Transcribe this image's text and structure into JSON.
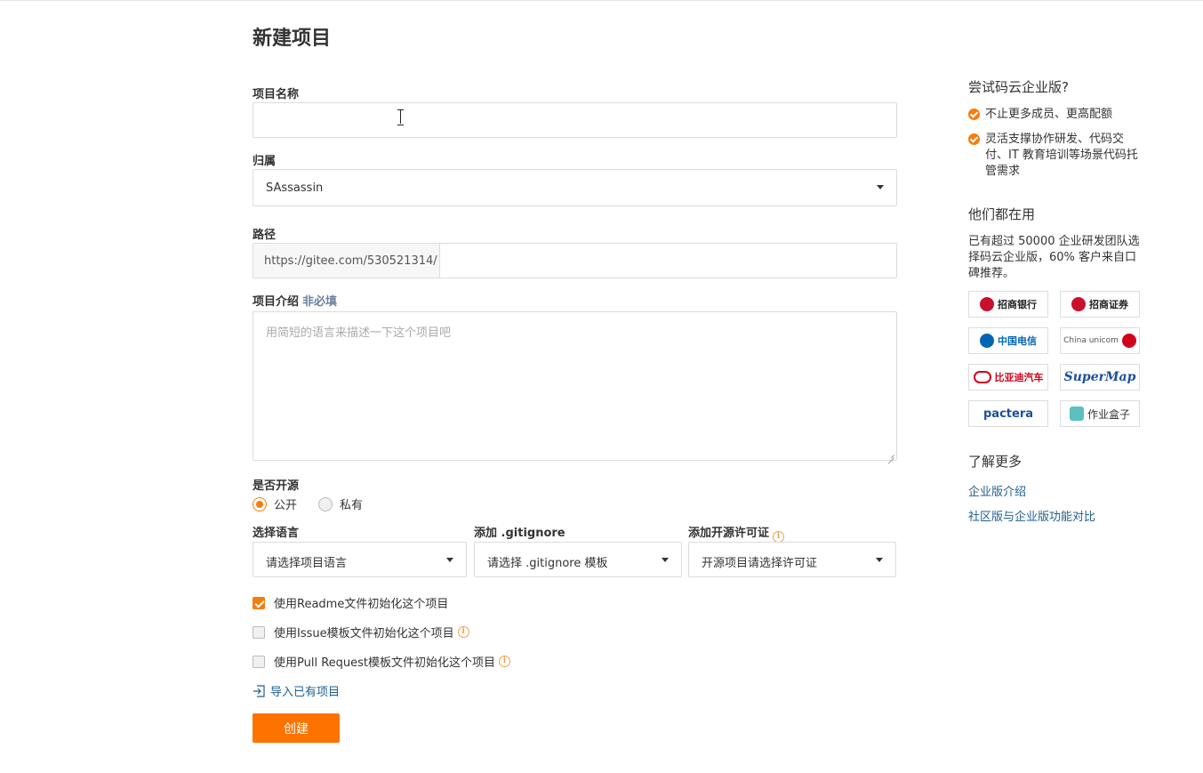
{
  "page": {
    "title": "新建项目"
  },
  "form": {
    "name": {
      "label": "项目名称",
      "value": ""
    },
    "owner": {
      "label": "归属",
      "value": "SAssassin"
    },
    "path": {
      "label": "路径",
      "prefix": "https://gitee.com/530521314/",
      "value": ""
    },
    "description": {
      "label": "项目介绍",
      "optional": "非必填",
      "placeholder": "用简短的语言来描述一下这个项目吧"
    },
    "visibility": {
      "label": "是否开源",
      "options": [
        "公开",
        "私有"
      ],
      "selected": "公开"
    },
    "language": {
      "label": "选择语言",
      "value": "请选择项目语言"
    },
    "gitignore": {
      "label": "添加 .gitignore",
      "value": "请选择 .gitignore 模板"
    },
    "license": {
      "label": "添加开源许可证",
      "value": "开源项目请选择许可证"
    },
    "checkboxes": [
      {
        "label": "使用Readme文件初始化这个项目",
        "checked": true,
        "info": false
      },
      {
        "label": "使用Issue模板文件初始化这个项目",
        "checked": false,
        "info": true
      },
      {
        "label": "使用Pull Request模板文件初始化这个项目",
        "checked": false,
        "info": true
      }
    ],
    "import_link": "导入已有项目",
    "submit_label": "创建",
    "info_glyph": "i"
  },
  "aside": {
    "enterprise_title": "尝试码云企业版?",
    "benefits": [
      "不止更多成员、更高配额",
      "灵活支撑协作研发、代码交付、IT 教育培训等场景代码托管需求"
    ],
    "users_title": "他们都在用",
    "users_desc": "已有超过 50000 企业研发团队选择码云企业版，60% 客户来自口碑推荐。",
    "logos": [
      {
        "text": "招商银行",
        "color": "#c8102e"
      },
      {
        "text": "招商证券",
        "color": "#c8102e"
      },
      {
        "text": "中国电信",
        "color": "#0066b3"
      },
      {
        "text": "China unicom",
        "color": "#d0021b"
      },
      {
        "text": "比亚迪汽车",
        "color": "#d0021b"
      },
      {
        "text": "SuperMap",
        "color": "#1b4f9c"
      },
      {
        "text": "pactera",
        "color": "#1b4f9c"
      },
      {
        "text": "作业盒子",
        "color": "#333333"
      }
    ],
    "more_title": "了解更多",
    "more_links": [
      "企业版介绍",
      "社区版与企业版功能对比"
    ]
  },
  "colors": {
    "accent": "#fe7300",
    "link": "#1f5f8f",
    "check": "#f57d0e"
  }
}
